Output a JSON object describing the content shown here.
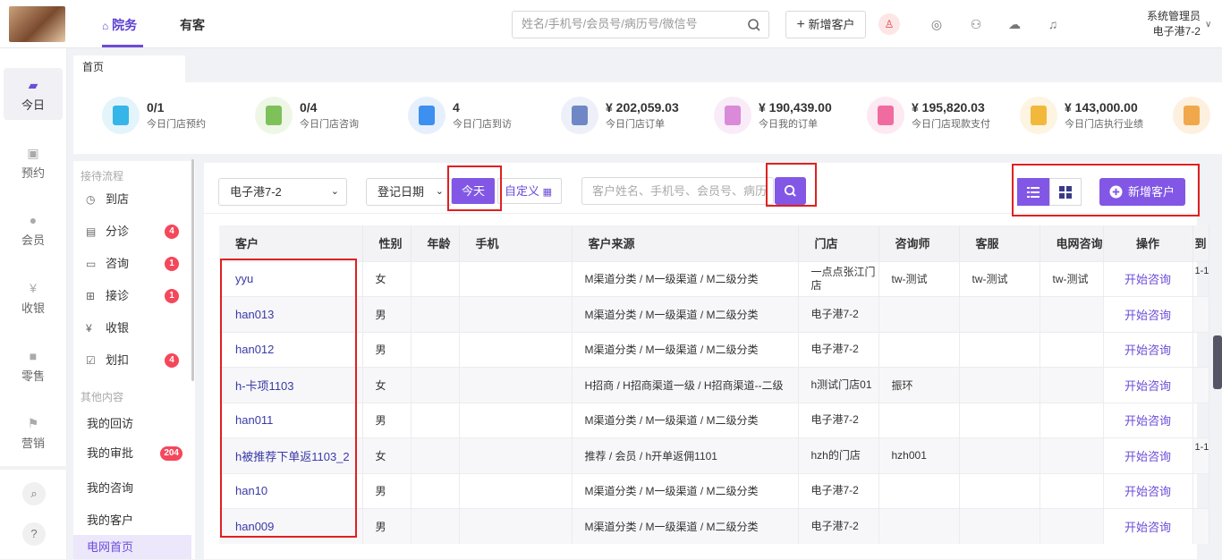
{
  "header": {
    "tabs": [
      {
        "label": "院务",
        "icon": "home-icon"
      },
      {
        "label": "有客"
      }
    ],
    "search_placeholder": "姓名/手机号/会员号/病历号/微信号",
    "add_customer": "新增客户",
    "user_role": "系统管理员",
    "user_store": "电子港7-2"
  },
  "sidebar": {
    "items": [
      {
        "label": "今日",
        "icon": "chart-icon"
      },
      {
        "label": "预约",
        "icon": "calendar-icon"
      },
      {
        "label": "会员",
        "icon": "member-icon"
      },
      {
        "label": "收银",
        "icon": "yen-icon"
      },
      {
        "label": "零售",
        "icon": "bag-icon"
      },
      {
        "label": "营销",
        "icon": "flag-icon"
      }
    ],
    "search_glyph": "⌕",
    "help_glyph": "?"
  },
  "page_tab": "首页",
  "stats": [
    {
      "value": "0/1",
      "label": "今日门店预约",
      "color": "#35b5e8",
      "bg": "#e3f4fb"
    },
    {
      "value": "0/4",
      "label": "今日门店咨询",
      "color": "#7ec15a",
      "bg": "#eef7e6"
    },
    {
      "value": "4",
      "label": "今日门店到访",
      "color": "#3d8ff0",
      "bg": "#e6f0fd"
    },
    {
      "value": "¥ 202,059.03",
      "label": "今日门店订单",
      "color": "#6f87c4",
      "bg": "#edf0f8"
    },
    {
      "value": "¥ 190,439.00",
      "label": "今日我的订单",
      "color": "#d98ad8",
      "bg": "#f9ecf8"
    },
    {
      "value": "¥ 195,820.03",
      "label": "今日门店现款支付",
      "color": "#f06ca0",
      "bg": "#fde9f1"
    },
    {
      "value": "¥ 143,000.00",
      "label": "今日门店执行业绩",
      "color": "#f2b83b",
      "bg": "#fdf4e1"
    },
    {
      "value": "",
      "label": "",
      "color": "#f0a84b",
      "bg": "#fdf0de"
    }
  ],
  "left_panel": {
    "section1": "接待流程",
    "flow": [
      {
        "label": "到店",
        "icon": "clock-icon",
        "badge": ""
      },
      {
        "label": "分诊",
        "icon": "triage-icon",
        "badge": "4"
      },
      {
        "label": "咨询",
        "icon": "chat-icon",
        "badge": "1"
      },
      {
        "label": "接诊",
        "icon": "medkit-icon",
        "badge": "1"
      },
      {
        "label": "收银",
        "icon": "yen-circle-icon",
        "badge": ""
      },
      {
        "label": "划扣",
        "icon": "checkbox-icon",
        "badge": "4"
      }
    ],
    "section2": "其他内容",
    "others": [
      {
        "label": "我的回访",
        "badge": ""
      },
      {
        "label": "我的审批",
        "badge": "204"
      },
      {
        "label": "我的咨询",
        "badge": ""
      },
      {
        "label": "我的客户",
        "badge": ""
      }
    ],
    "active": "电网首页"
  },
  "filters": {
    "store": "电子港7-2",
    "date_type": "登记日期",
    "today": "今天",
    "custom": "自定义",
    "keyword_placeholder": "客户姓名、手机号、会员号、病历号",
    "new_customer": "新增客户"
  },
  "table": {
    "columns": [
      "客户",
      "性别",
      "年龄",
      "手机",
      "客户来源",
      "门店",
      "咨询师",
      "客服",
      "电网咨询",
      "操作",
      "到"
    ],
    "rows": [
      {
        "name": "yyu",
        "gender": "女",
        "age": "",
        "phone": "",
        "source": "M渠道分类 / M一级渠道 / M二级分类",
        "store": "一点点张江门店",
        "consultant": "tw-测试",
        "service": "tw-测试",
        "net": "tw-测试",
        "op": "开始咨询",
        "extra": "1-1"
      },
      {
        "name": "han013",
        "gender": "男",
        "age": "",
        "phone": "",
        "source": "M渠道分类 / M一级渠道 / M二级分类",
        "store": "电子港7-2",
        "consultant": "",
        "service": "",
        "net": "",
        "op": "开始咨询",
        "extra": ""
      },
      {
        "name": "han012",
        "gender": "男",
        "age": "",
        "phone": "",
        "source": "M渠道分类 / M一级渠道 / M二级分类",
        "store": "电子港7-2",
        "consultant": "",
        "service": "",
        "net": "",
        "op": "开始咨询",
        "extra": ""
      },
      {
        "name": "h-卡项1103",
        "gender": "女",
        "age": "",
        "phone": "",
        "source": "H招商 / H招商渠道一级 / H招商渠道--二级",
        "store": "h测试门店01",
        "consultant": "振环",
        "service": "",
        "net": "",
        "op": "开始咨询",
        "extra": ""
      },
      {
        "name": "han011",
        "gender": "男",
        "age": "",
        "phone": "",
        "source": "M渠道分类 / M一级渠道 / M二级分类",
        "store": "电子港7-2",
        "consultant": "",
        "service": "",
        "net": "",
        "op": "开始咨询",
        "extra": ""
      },
      {
        "name": "h被推荐下单返1103_2",
        "gender": "女",
        "age": "",
        "phone": "",
        "source": "推荐 / 会员 / h开单返佣1101",
        "store": "hzh的门店",
        "consultant": "hzh001",
        "service": "",
        "net": "",
        "op": "开始咨询",
        "extra": "1-1"
      },
      {
        "name": "han10",
        "gender": "男",
        "age": "",
        "phone": "",
        "source": "M渠道分类 / M一级渠道 / M二级分类",
        "store": "电子港7-2",
        "consultant": "",
        "service": "",
        "net": "",
        "op": "开始咨询",
        "extra": ""
      },
      {
        "name": "han009",
        "gender": "男",
        "age": "",
        "phone": "",
        "source": "M渠道分类 / M一级渠道 / M二级分类",
        "store": "电子港7-2",
        "consultant": "",
        "service": "",
        "net": "",
        "op": "开始咨询",
        "extra": ""
      }
    ]
  },
  "colors": {
    "accent": "#8257e5",
    "highlight": "#e02020",
    "badge": "#f5475b"
  }
}
